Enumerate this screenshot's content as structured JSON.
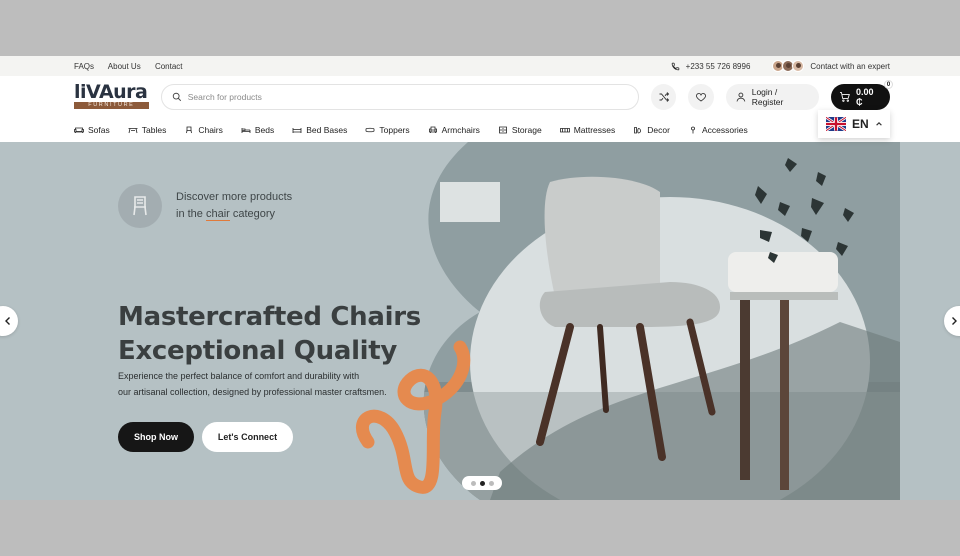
{
  "topbar": {
    "links": [
      "FAQs",
      "About Us",
      "Contact"
    ],
    "phone": "+233 55 726 8996",
    "expert_text": "Contact with an expert"
  },
  "header": {
    "logo_main": "liVAura",
    "logo_sub": "FURNITURE",
    "search_placeholder": "Search for products",
    "login_label": "Login / Register",
    "cart_total": "0.00 ₵",
    "cart_count": "0"
  },
  "nav": {
    "items": [
      {
        "label": "Sofas",
        "icon": "sofa-icon"
      },
      {
        "label": "Tables",
        "icon": "table-icon"
      },
      {
        "label": "Chairs",
        "icon": "chair-icon"
      },
      {
        "label": "Beds",
        "icon": "bed-icon"
      },
      {
        "label": "Bed Bases",
        "icon": "bed-base-icon"
      },
      {
        "label": "Toppers",
        "icon": "topper-icon"
      },
      {
        "label": "Armchairs",
        "icon": "armchair-icon"
      },
      {
        "label": "Storage",
        "icon": "storage-icon"
      },
      {
        "label": "Mattresses",
        "icon": "mattress-icon"
      },
      {
        "label": "Decor",
        "icon": "decor-icon"
      },
      {
        "label": "Accessories",
        "icon": "accessories-icon"
      }
    ],
    "language": "EN"
  },
  "hero": {
    "discover_line1": "Discover more products",
    "discover_line2_pre": "in the ",
    "discover_line2_link": "chair",
    "discover_line2_post": " category",
    "headline_line1": "Mastercrafted Chairs",
    "headline_line2": "Exceptional Quality",
    "desc_line1": "Experience the perfect balance of comfort and durability with",
    "desc_line2": "our artisanal collection, designed by professional master craftsmen.",
    "shop_label": "Shop Now",
    "connect_label": "Let's Connect",
    "slide_count": 3,
    "active_slide": 2
  },
  "colors": {
    "hero_bg": "#b5c1c4",
    "accent_orange": "#e58a4f",
    "dark": "#161616",
    "logo_brown": "#8c5a3a"
  }
}
